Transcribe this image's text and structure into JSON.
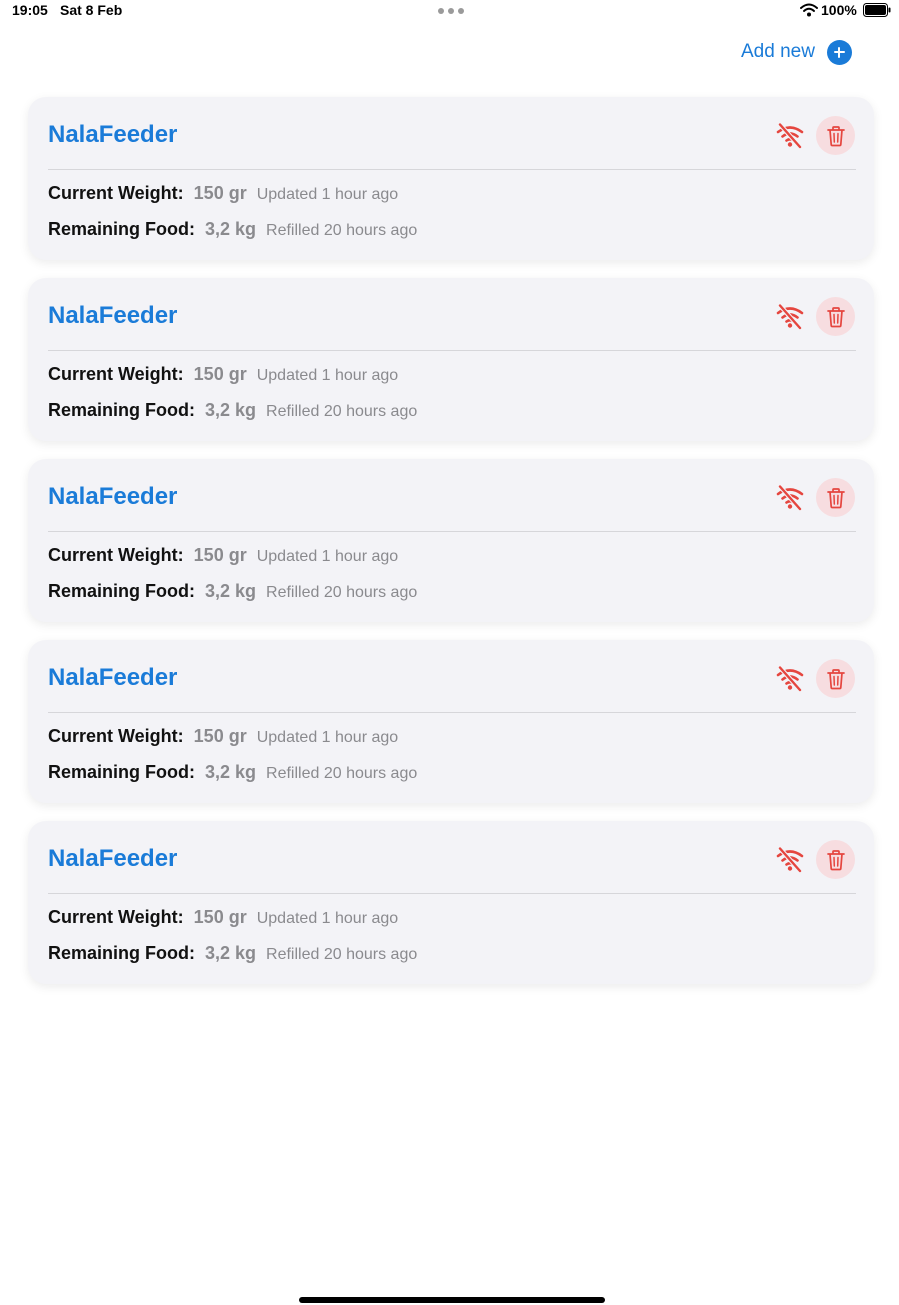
{
  "status_bar": {
    "time": "19:05",
    "date": "Sat 8 Feb",
    "battery": "100%"
  },
  "header": {
    "add_new_label": "Add new"
  },
  "colors": {
    "accent": "#1a7bd8",
    "danger": "#e5463f",
    "card_bg": "#f3f3f7",
    "muted_text": "#8a8a8e"
  },
  "feeders": [
    {
      "name": "NalaFeeder",
      "weight_label": "Current Weight:",
      "weight_value": "150 gr",
      "weight_note": "Updated 1 hour ago",
      "food_label": "Remaining Food:",
      "food_value": "3,2 kg",
      "food_note": "Refilled 20 hours ago",
      "status_icon": "wifi-off-icon",
      "action_icon": "trash-icon"
    },
    {
      "name": "NalaFeeder",
      "weight_label": "Current Weight:",
      "weight_value": "150 gr",
      "weight_note": "Updated 1 hour ago",
      "food_label": "Remaining Food:",
      "food_value": "3,2 kg",
      "food_note": "Refilled 20 hours ago",
      "status_icon": "wifi-off-icon",
      "action_icon": "trash-icon"
    },
    {
      "name": "NalaFeeder",
      "weight_label": "Current Weight:",
      "weight_value": "150 gr",
      "weight_note": "Updated 1 hour ago",
      "food_label": "Remaining Food:",
      "food_value": "3,2 kg",
      "food_note": "Refilled 20 hours ago",
      "status_icon": "wifi-off-icon",
      "action_icon": "trash-icon"
    },
    {
      "name": "NalaFeeder",
      "weight_label": "Current Weight:",
      "weight_value": "150 gr",
      "weight_note": "Updated 1 hour ago",
      "food_label": "Remaining Food:",
      "food_value": "3,2 kg",
      "food_note": "Refilled 20 hours ago",
      "status_icon": "wifi-off-icon",
      "action_icon": "trash-icon"
    },
    {
      "name": "NalaFeeder",
      "weight_label": "Current Weight:",
      "weight_value": "150 gr",
      "weight_note": "Updated 1 hour ago",
      "food_label": "Remaining Food:",
      "food_value": "3,2 kg",
      "food_note": "Refilled 20 hours ago",
      "status_icon": "wifi-off-icon",
      "action_icon": "trash-icon"
    }
  ]
}
